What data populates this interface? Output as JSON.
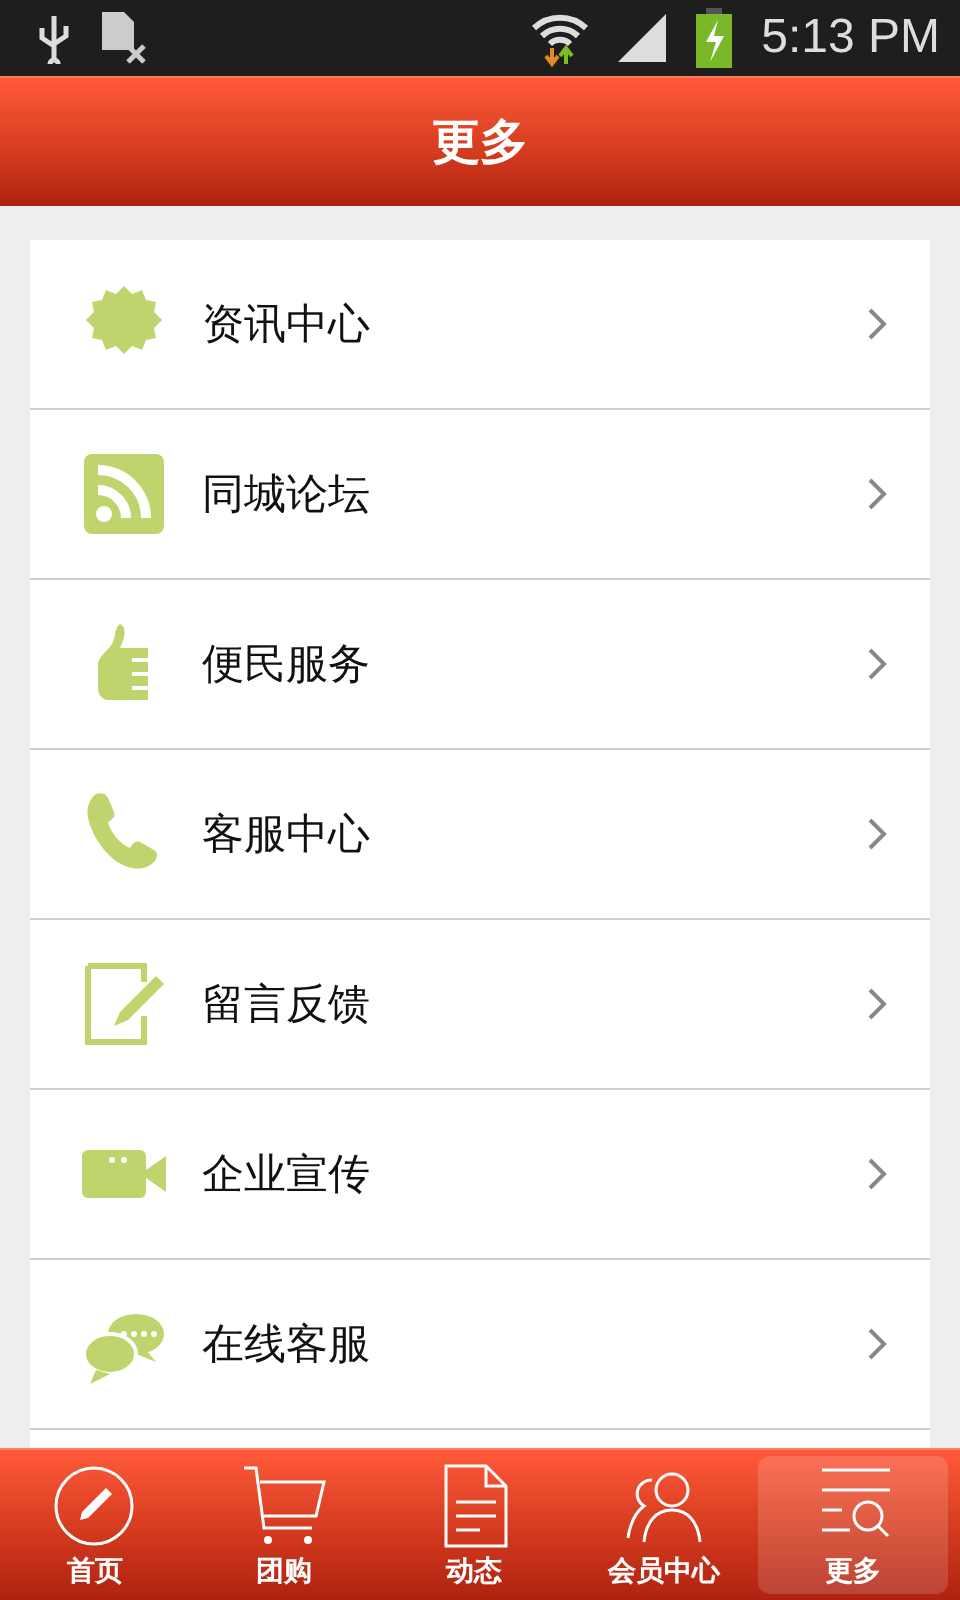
{
  "status_bar": {
    "time": "5:13 PM"
  },
  "header": {
    "title": "更多"
  },
  "menu": [
    {
      "kind": "new",
      "label": "资讯中心"
    },
    {
      "kind": "rss",
      "label": "同城论坛"
    },
    {
      "kind": "thumb",
      "label": "便民服务"
    },
    {
      "kind": "phone",
      "label": "客服中心"
    },
    {
      "kind": "edit",
      "label": "留言反馈"
    },
    {
      "kind": "video",
      "label": "企业宣传"
    },
    {
      "kind": "chat",
      "label": "在线客服"
    }
  ],
  "tab_bar": [
    {
      "kind": "home",
      "label": "首页",
      "selected": false
    },
    {
      "kind": "cart",
      "label": "团购",
      "selected": false
    },
    {
      "kind": "doc",
      "label": "动态",
      "selected": false
    },
    {
      "kind": "users",
      "label": "会员中心",
      "selected": false
    },
    {
      "kind": "more",
      "label": "更多",
      "selected": true
    }
  ]
}
